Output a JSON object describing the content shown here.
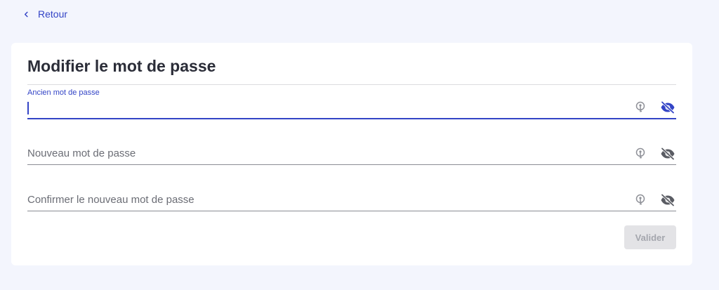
{
  "nav": {
    "back_label": "Retour"
  },
  "page": {
    "title": "Modifier le mot de passe"
  },
  "fields": [
    {
      "label": "Ancien mot de passe",
      "value": "",
      "state": "focused",
      "key_icon": "key-icon",
      "visibility_icon": "eye-off-icon"
    },
    {
      "placeholder": "Nouveau mot de passe",
      "value": "",
      "state": "idle",
      "key_icon": "key-icon",
      "visibility_icon": "eye-off-icon"
    },
    {
      "placeholder": "Confirmer le nouveau mot de passe",
      "value": "",
      "state": "idle",
      "key_icon": "key-icon",
      "visibility_icon": "eye-off-icon"
    }
  ],
  "actions": {
    "submit_label": "Valider",
    "submit_enabled": false
  },
  "colors": {
    "accent": "#3344c6",
    "background": "#f3f5fd",
    "card": "#ffffff",
    "disabled_button": "#e3e3e6",
    "icon_gray": "#8f9198",
    "eye_gray": "#5a5c63"
  }
}
